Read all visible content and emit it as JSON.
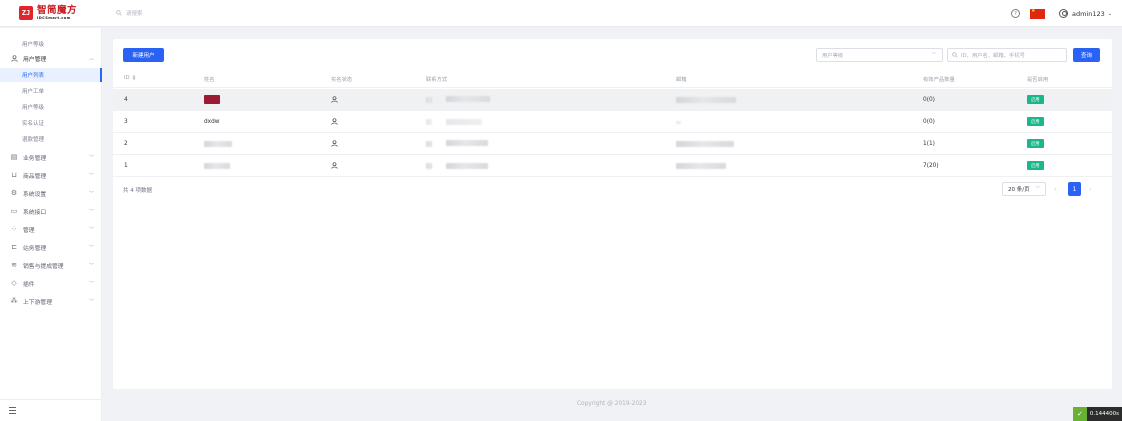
{
  "header": {
    "logo_cn": "智简魔方",
    "logo_en": "IDCSmart.com",
    "logo_mark": "ZJ",
    "search_placeholder": "请搜索",
    "username": "admin123",
    "user_caret": "⌄",
    "help_glyph": "?"
  },
  "sidebar": {
    "items": [
      {
        "label": "用户等级"
      },
      {
        "label": "用户管理",
        "icon": "user-icon",
        "expanded": true
      },
      {
        "label": "用户列表",
        "active": true
      },
      {
        "label": "用户工单"
      },
      {
        "label": "用户等级"
      },
      {
        "label": "实名认证"
      },
      {
        "label": "退款管理"
      },
      {
        "label": "业务管理",
        "icon": "business-icon"
      },
      {
        "label": "商品管理",
        "icon": "cart-icon"
      },
      {
        "label": "系统设置",
        "icon": "gear-icon"
      },
      {
        "label": "系统接口",
        "icon": "folder-icon"
      },
      {
        "label": "管理",
        "icon": "apps-icon"
      },
      {
        "label": "站务管理",
        "icon": "site-icon"
      },
      {
        "label": "销售与提成管理",
        "icon": "sales-icon"
      },
      {
        "label": "插件",
        "icon": "plugin-icon"
      },
      {
        "label": "上下游管理",
        "icon": "network-icon"
      }
    ]
  },
  "toolbar": {
    "new_user_label": "新建用户",
    "level_placeholder": "用户等级",
    "search_placeholder": "ID、用户名、邮箱、手机号",
    "query_label": "查询"
  },
  "table": {
    "columns": [
      "ID",
      "姓名",
      "实名状态",
      "联系方式",
      "邮箱",
      "有效产品数量",
      "是否启用"
    ],
    "rows": [
      {
        "id": "4",
        "name": "",
        "product_count": "0(0)",
        "status": "启用"
      },
      {
        "id": "3",
        "name": "dxdw",
        "product_count": "0(0)",
        "status": "启用"
      },
      {
        "id": "2",
        "name": "",
        "product_count": "1(1)",
        "status": "启用"
      },
      {
        "id": "1",
        "name": "",
        "product_count": "7(20)",
        "status": "启用"
      }
    ]
  },
  "pagination": {
    "total_text": "共 4 项数据",
    "page_size": "20 条/页",
    "current_page": "1",
    "prev": "‹",
    "next": "›"
  },
  "footer": {
    "copyright": "Copyright @ 2019-2023",
    "timing": "0.144400s"
  },
  "colors": {
    "primary": "#2a62f5",
    "success": "#19b78a",
    "brand_red": "#e0262b"
  }
}
